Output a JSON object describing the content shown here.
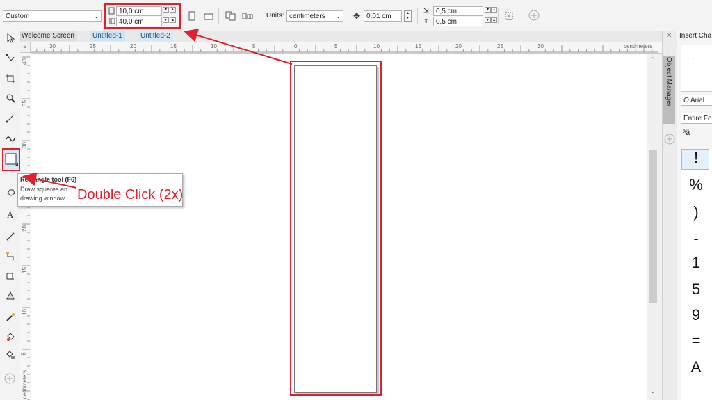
{
  "propbar": {
    "preset": "Custom",
    "width": "10,0 cm",
    "height": "40,0 cm",
    "units_label": "Units:",
    "units_value": "centimeters",
    "nudge": "0,01 cm",
    "dup_x": "0,5 cm",
    "dup_y": "0,5 cm"
  },
  "tabs": [
    {
      "label": "Welcome Screen"
    },
    {
      "label": "Untitled-1"
    },
    {
      "label": "Untitled-2"
    }
  ],
  "ruler": {
    "h_ticks": [
      "30",
      "25",
      "20",
      "15",
      "10",
      "5",
      "0",
      "5",
      "10",
      "15",
      "20",
      "25",
      "30"
    ],
    "h_unit": "centimeters",
    "v_ticks": [
      "40",
      "35",
      "30",
      "25",
      "20",
      "15",
      "10",
      "5"
    ],
    "v_unit": "centimeters"
  },
  "tooltip": {
    "title": "Rectangle tool (F6)",
    "line1": "Draw squares an",
    "line2": "drawing window"
  },
  "annotation": {
    "text": "Double Click (2x)",
    "color": "#e0202a"
  },
  "docker": {
    "object_manager": "Object Manager",
    "insert_char": "Insert Cha",
    "font": "Arial",
    "filter": "Entire Fo",
    "glyphs": [
      "!",
      "%",
      ")",
      "-",
      "1",
      "5",
      "9",
      "=",
      "A"
    ]
  }
}
